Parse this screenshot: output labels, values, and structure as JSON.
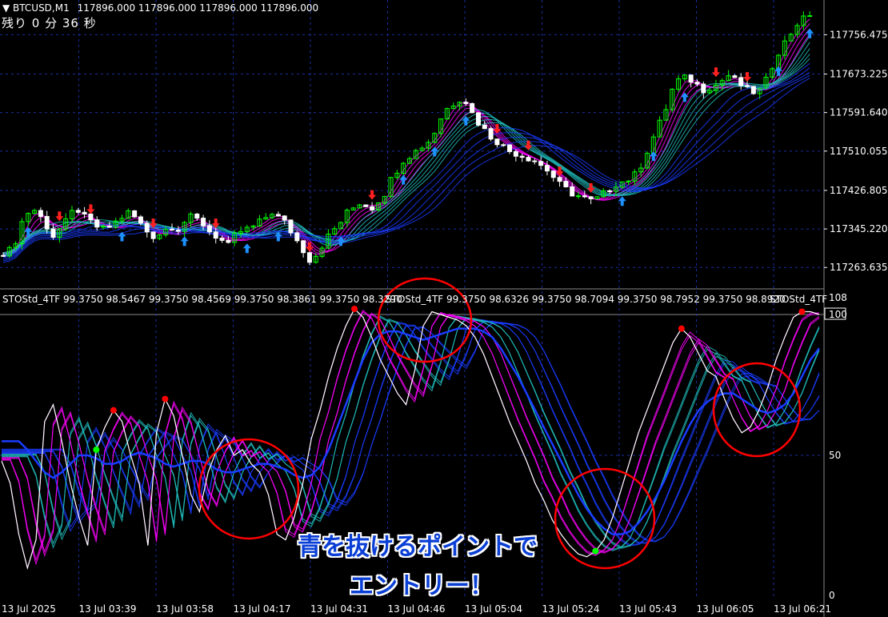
{
  "header": {
    "symbol": "BTCUSD,M1",
    "ohlc": "117896.000 117896.000 117896.000 117896.000",
    "timer": "残り 0 分 36 秒"
  },
  "indicator": {
    "title_segments": [
      "STOStd_4TF 99.3750 98.5467 99.3750 98.4569 99.3750 98.3861 99.3750 98.3290",
      "STOStd_4TF 99.3750 98.6326 99.3750 98.7094 99.3750 98.7952 99.3750 98.8920",
      "STOStd_4TF"
    ],
    "max_label": "100",
    "mid_label": "50",
    "current_label": "100",
    "level_108": "108",
    "zero_label": "0"
  },
  "annotation": {
    "line1": "青を抜けるポイントで",
    "line2": "エントリー！"
  },
  "colors": {
    "background": "#000000",
    "grid": "#1a2fa0",
    "bull_candle": "#00ff00",
    "bear_candle": "#ffffff",
    "ma_fast": "#ff00ff",
    "ma_mid": "#20c0c0",
    "ma_slow": "#1a3cff",
    "sto_main": "#ffffff",
    "signal_up": "#00ff00",
    "signal_down": "#ff0000",
    "arrow_up": "#1e90ff",
    "arrow_down": "#ff2020",
    "circle": "#ff0000"
  },
  "chart_data": [
    {
      "type": "candlestick",
      "title": "BTCUSD,M1",
      "ylim": [
        117220,
        117830
      ],
      "y_ticks": [
        "117756.475",
        "117673.225",
        "117591.640",
        "117510.055",
        "117426.805",
        "117345.220",
        "117263.635"
      ],
      "y_tick_values": [
        117756.475,
        117673.225,
        117591.64,
        117510.055,
        117426.805,
        117345.22,
        117263.635
      ],
      "x_ticks": [
        "13 Jul 2025",
        "13 Jul 03:39",
        "13 Jul 03:58",
        "13 Jul 04:17",
        "13 Jul 04:31",
        "13 Jul 04:46",
        "13 Jul 05:04",
        "13 Jul 05:24",
        "13 Jul 05:43",
        "13 Jul 06:05",
        "13 Jul 06:21"
      ],
      "close_path": [
        117295,
        117300,
        117320,
        117360,
        117380,
        117385,
        117370,
        117350,
        117330,
        117345,
        117360,
        117380,
        117385,
        117370,
        117360,
        117350,
        117345,
        117350,
        117360,
        117370,
        117380,
        117370,
        117355,
        117340,
        117330,
        117335,
        117345,
        117350,
        117345,
        117360,
        117370,
        117365,
        117355,
        117340,
        117330,
        117320,
        117310,
        117330,
        117340,
        117345,
        117350,
        117360,
        117370,
        117380,
        117370,
        117360,
        117340,
        117320,
        117300,
        117280,
        117290,
        117310,
        117330,
        117345,
        117360,
        117380,
        117390,
        117400,
        117395,
        117390,
        117405,
        117420,
        117450,
        117470,
        117490,
        117500,
        117510,
        117520,
        117530,
        117550,
        117580,
        117600,
        117610,
        117620,
        117615,
        117590,
        117570,
        117555,
        117540,
        117530,
        117520,
        117510,
        117505,
        117500,
        117495,
        117490,
        117480,
        117470,
        117455,
        117440,
        117430,
        117420,
        117415,
        117410,
        117405,
        117410,
        117420,
        117430,
        117440,
        117445,
        117450,
        117460,
        117480,
        117510,
        117540,
        117570,
        117600,
        117640,
        117660,
        117665,
        117660,
        117650,
        117640,
        117645,
        117650,
        117660,
        117670,
        117660,
        117650,
        117640,
        117635,
        117640,
        117660,
        117690,
        117720,
        117740,
        117760,
        117780,
        117790,
        117800
      ],
      "series": [
        {
          "name": "MA fast",
          "color": "#ff00ff"
        },
        {
          "name": "MA mid",
          "color": "#20c0c0"
        },
        {
          "name": "MA slow",
          "color": "#1a3cff"
        }
      ]
    },
    {
      "type": "line",
      "title": "STOStd_4TF",
      "ylim": [
        0,
        108
      ],
      "y_ticks": [
        "100",
        "50",
        "0"
      ],
      "x_ticks": [
        "13 Jul 2025",
        "13 Jul 03:39",
        "13 Jul 03:58",
        "13 Jul 04:17",
        "13 Jul 04:31",
        "13 Jul 04:46",
        "13 Jul 05:04",
        "13 Jul 05:24",
        "13 Jul 05:43",
        "13 Jul 06:05",
        "13 Jul 06:21"
      ],
      "series": [
        {
          "name": "STOStd_4TF",
          "values": [
            48,
            40,
            22,
            10,
            20,
            62,
            68,
            55,
            40,
            28,
            18,
            52,
            60,
            66,
            62,
            50,
            40,
            18,
            58,
            70,
            64,
            50,
            36,
            30,
            44,
            52,
            57,
            50,
            52,
            47,
            44,
            36,
            22,
            20,
            28,
            40,
            56,
            66,
            78,
            88,
            96,
            102,
            99,
            92,
            84,
            78,
            72,
            68,
            80,
            96,
            101,
            100,
            99,
            98,
            96,
            92,
            86,
            78,
            70,
            62,
            55,
            48,
            40,
            34,
            27,
            22,
            18,
            15,
            14,
            16,
            20,
            28,
            38,
            48,
            58,
            66,
            74,
            82,
            90,
            95,
            92,
            86,
            80,
            78,
            70,
            63,
            58,
            60,
            66,
            74,
            84,
            92,
            99,
            101,
            101,
            100
          ]
        },
        {
          "name": "STO slow",
          "values": [
            55,
            52,
            48,
            44,
            42,
            44,
            47,
            50,
            50,
            49,
            47,
            47,
            48,
            50,
            51,
            50,
            49,
            47,
            46,
            47,
            48,
            48,
            47,
            45,
            44,
            44,
            45,
            46,
            47,
            47,
            46,
            45,
            43,
            42,
            43,
            46,
            52,
            60,
            68,
            76,
            84,
            90,
            93,
            94,
            94,
            93,
            92,
            91,
            92,
            93,
            94,
            95,
            95,
            95,
            94,
            92,
            88,
            83,
            78,
            72,
            66,
            60,
            54,
            48,
            42,
            36,
            31,
            27,
            24,
            22,
            22,
            23,
            26,
            30,
            35,
            41,
            48,
            55,
            61,
            66,
            69,
            71,
            72,
            72,
            70,
            68,
            66,
            65,
            66,
            68,
            72,
            78,
            84,
            88,
            91,
            93
          ]
        }
      ],
      "upper_level": 100,
      "middle_level": 50
    }
  ]
}
